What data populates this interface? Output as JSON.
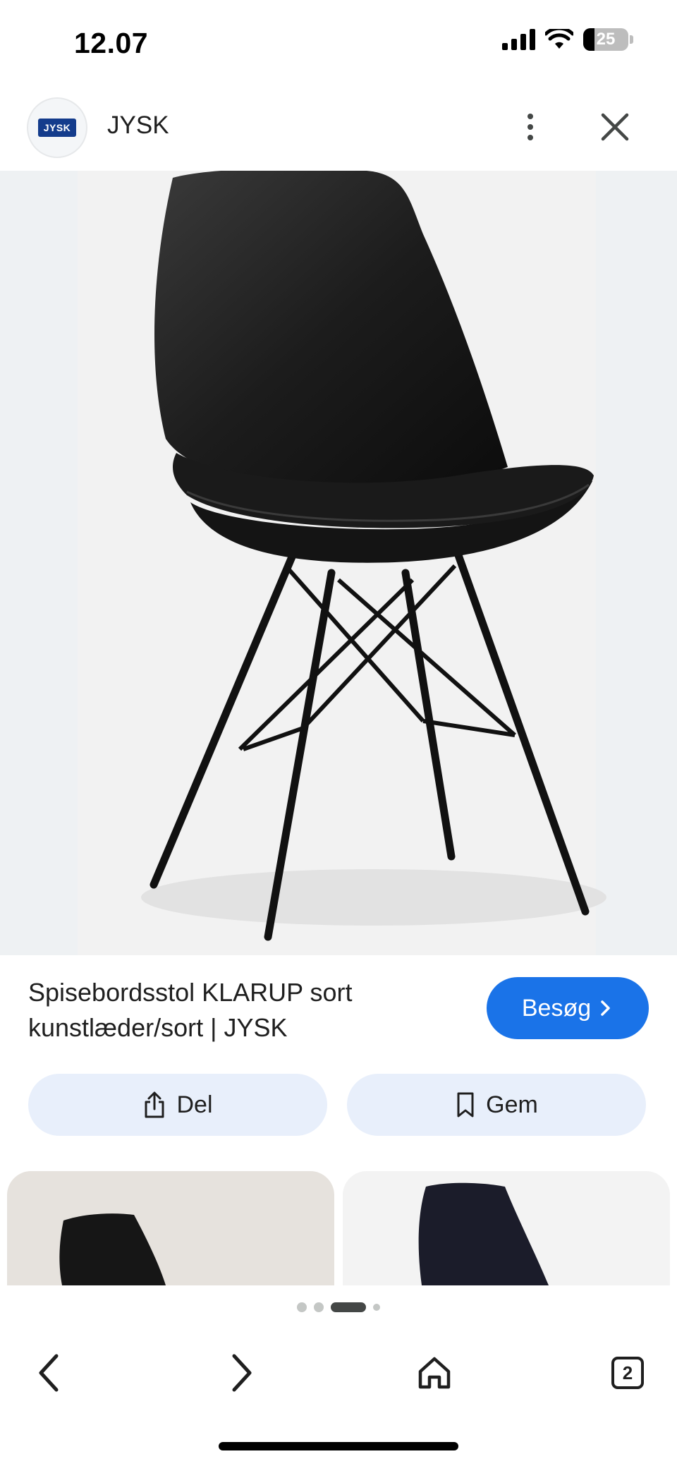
{
  "status_bar": {
    "time": "12.07",
    "battery_level": "25",
    "icons": [
      "cellular-signal-icon",
      "wifi-icon",
      "battery-icon"
    ]
  },
  "header": {
    "site_logo_text": "JYSK",
    "site_name": "JYSK",
    "icons": [
      "more-vertical-icon",
      "close-icon"
    ]
  },
  "product": {
    "image": "chair-product-image",
    "title": "Spisebordsstol KLARUP sort kunstlæder/sort | JYSK",
    "visit_label": "Besøg"
  },
  "actions": {
    "share_label": "Del",
    "save_label": "Gem"
  },
  "related_results": [
    "related-chair-thumbnail",
    "related-chair-thumbnail"
  ],
  "pager": {
    "active_index": 2,
    "count": 4
  },
  "bottom_nav": {
    "tab_count": "2",
    "icons": [
      "back-arrow-icon",
      "forward-arrow-icon",
      "home-icon",
      "tabs-icon"
    ]
  },
  "colors": {
    "accent": "#1a73e8",
    "action_button_bg": "#e8effb",
    "image_bg": "#eef1f3",
    "text": "#1f1f1f"
  }
}
